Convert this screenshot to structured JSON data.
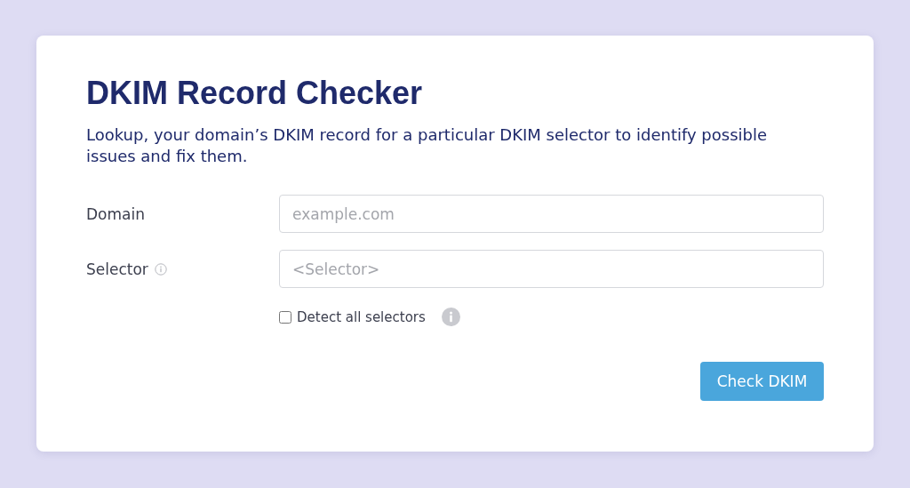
{
  "title": "DKIM Record Checker",
  "description": "Lookup, your domain’s DKIM record for a particular DKIM selector to identify possible issues and fix them.",
  "fields": [
    {
      "label": "Domain",
      "placeholder": "example.com",
      "info": false
    },
    {
      "label": "Selector",
      "placeholder": "<Selector>",
      "info": true
    }
  ],
  "detect_all": {
    "label": "Detect all selectors",
    "checked": false
  },
  "button": "Check DKIM"
}
